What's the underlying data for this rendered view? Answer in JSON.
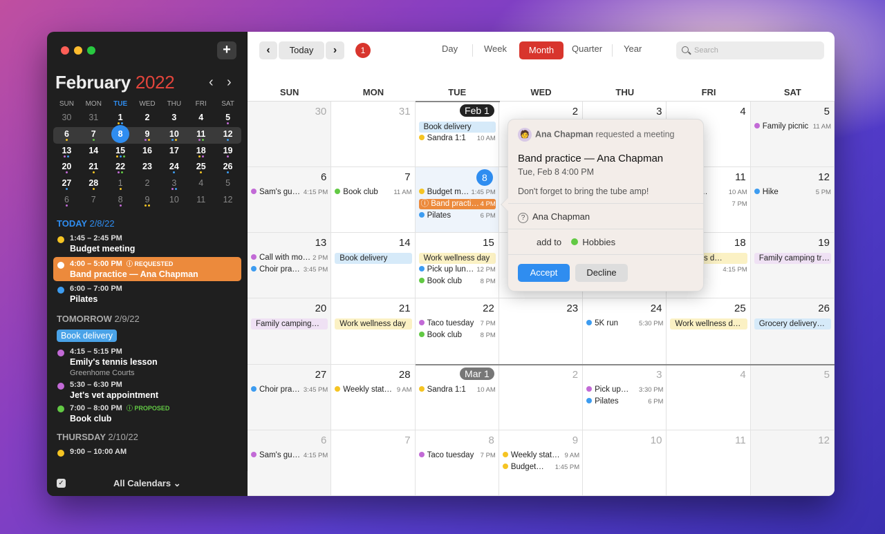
{
  "colors": {
    "yellow": "#f5c423",
    "orange": "#ec8a3c",
    "blue": "#3d9cf0",
    "green": "#62c944",
    "purple": "#c26ad6",
    "red": "#d8352d"
  },
  "sidebar": {
    "month": "February",
    "year": "2022",
    "dow": [
      "SUN",
      "MON",
      "TUE",
      "WED",
      "THU",
      "FRI",
      "SAT"
    ],
    "weeks": [
      [
        "30",
        "31",
        "1",
        "2",
        "3",
        "4",
        "5"
      ],
      [
        "6",
        "7",
        "8",
        "9",
        "10",
        "11",
        "12"
      ],
      [
        "13",
        "14",
        "15",
        "16",
        "17",
        "18",
        "19"
      ],
      [
        "20",
        "21",
        "22",
        "23",
        "24",
        "25",
        "26"
      ],
      [
        "27",
        "28",
        "1",
        "2",
        "3",
        "4",
        "5"
      ],
      [
        "6",
        "7",
        "8",
        "9",
        "10",
        "11",
        "12"
      ]
    ],
    "today_label": "TODAY",
    "today_date": "2/8/22",
    "tomorrow_label": "TOMORROW",
    "tomorrow_date": "2/9/22",
    "thursday_label": "THURSDAY",
    "thursday_date": "2/10/22",
    "today_items": [
      {
        "time": "1:45 – 2:45 PM",
        "title": "Budget meeting"
      },
      {
        "time": "4:00 – 5:00 PM",
        "tag": "REQUESTED",
        "title": "Band practice — Ana Chapman"
      },
      {
        "time": "6:00 – 7:00 PM",
        "title": "Pilates"
      }
    ],
    "book_delivery": "Book delivery",
    "tomorrow_items": [
      {
        "time": "4:15 – 5:15 PM",
        "title": "Emily's tennis lesson",
        "sub": "Greenhome Courts"
      },
      {
        "time": "5:30 – 6:30 PM",
        "title": "Jet's vet appointment"
      },
      {
        "time": "7:00 – 8:00 PM",
        "tag": "PROPOSED",
        "title": "Book club"
      }
    ],
    "thursday_item_time": "9:00 – 10:00 AM",
    "all_calendars": "All Calendars ⌄"
  },
  "toolbar": {
    "today": "Today",
    "badge": "1",
    "views": [
      "Day",
      "Week",
      "Month",
      "Quarter",
      "Year"
    ],
    "search_placeholder": "Search"
  },
  "grid": {
    "dow": [
      "SUN",
      "MON",
      "TUE",
      "WED",
      "THU",
      "FRI",
      "SAT"
    ],
    "days": [
      [
        "30",
        "31",
        "Feb 1",
        "2",
        "3",
        "4",
        "5"
      ],
      [
        "6",
        "7",
        "8",
        "9",
        "10",
        "11",
        "12"
      ],
      [
        "13",
        "14",
        "15",
        "16",
        "17",
        "18",
        "19"
      ],
      [
        "20",
        "21",
        "22",
        "23",
        "24",
        "25",
        "26"
      ],
      [
        "27",
        "28",
        "Mar 1",
        "2",
        "3",
        "4",
        "5"
      ],
      [
        "6",
        "7",
        "8",
        "9",
        "10",
        "11",
        "12"
      ]
    ],
    "events": {
      "r0c2": [
        {
          "t": "Book delivery",
          "bar": "#d6eaf9"
        },
        {
          "t": "Sandra 1:1",
          "time": "10 AM",
          "c": "yellow"
        }
      ],
      "r0c6": [
        {
          "t": "Family picnic",
          "time": "11 AM",
          "c": "purple"
        }
      ],
      "r1c0": [
        {
          "t": "Sam's gu…",
          "time": "4:15 PM",
          "c": "purple"
        }
      ],
      "r1c1": [
        {
          "t": "Book club",
          "time": "11 AM",
          "c": "green"
        }
      ],
      "r1c2": [
        {
          "t": "Budget m…",
          "time": "1:45 PM",
          "c": "yellow"
        },
        {
          "t": "Band practi…",
          "time": "4 PM",
          "sel": true
        },
        {
          "t": "Pilates",
          "time": "6 PM",
          "c": "blue"
        }
      ],
      "r1c5": [
        {
          "t": "…te d…",
          "time": "10 AM",
          "c": "none"
        },
        {
          "t": "…club",
          "time": "7 PM",
          "c": "none"
        }
      ],
      "r1c6": [
        {
          "t": "Hike",
          "time": "5 PM",
          "c": "blue"
        }
      ],
      "r2c0": [
        {
          "t": "Call with mo…",
          "time": "2 PM",
          "c": "purple"
        },
        {
          "t": "Choir pra…",
          "time": "3:45 PM",
          "c": "blue"
        }
      ],
      "r2c1": [
        {
          "t": "Book delivery",
          "bar": "#d6eaf9"
        }
      ],
      "r2c2": [
        {
          "t": "Work wellness day",
          "bar": "#fbf1c4"
        },
        {
          "t": "Pick up lun…",
          "time": "12 PM",
          "c": "blue"
        },
        {
          "t": "Book club",
          "time": "8 PM",
          "c": "green"
        }
      ],
      "r2c5": [
        {
          "t": "…ellness d…",
          "bar": "#fbf1c4"
        },
        {
          "t": "…gu…",
          "time": "4:15 PM",
          "c": "none"
        }
      ],
      "r2c6": [
        {
          "t": "Family camping tr…",
          "bar": "#efe1f4"
        }
      ],
      "r3c0": [
        {
          "t": "Family camping…",
          "bar": "#efe1f4"
        }
      ],
      "r3c1": [
        {
          "t": "Work wellness day",
          "bar": "#fbf1c4"
        }
      ],
      "r3c2": [
        {
          "t": "Taco tuesday",
          "time": "7 PM",
          "c": "purple"
        },
        {
          "t": "Book club",
          "time": "8 PM",
          "c": "green"
        }
      ],
      "r3c4": [
        {
          "t": "5K run",
          "time": "5:30 PM",
          "c": "blue"
        }
      ],
      "r3c5": [
        {
          "t": "Work wellness d…",
          "bar": "#fbf1c4"
        }
      ],
      "r3c6": [
        {
          "t": "Grocery delivery…",
          "bar": "#d6eaf9"
        }
      ],
      "r4c0": [
        {
          "t": "Choir pra…",
          "time": "3:45 PM",
          "c": "blue"
        }
      ],
      "r4c1": [
        {
          "t": "Weekly stat…",
          "time": "9 AM",
          "c": "yellow"
        }
      ],
      "r4c2": [
        {
          "t": "Sandra 1:1",
          "time": "10 AM",
          "c": "yellow"
        }
      ],
      "r4c4": [
        {
          "t": "Pick up…",
          "time": "3:30 PM",
          "c": "purple"
        },
        {
          "t": "Pilates",
          "time": "6 PM",
          "c": "blue"
        }
      ],
      "r5c0": [
        {
          "t": "Sam's gu…",
          "time": "4:15 PM",
          "c": "purple"
        }
      ],
      "r5c2": [
        {
          "t": "Taco tuesday",
          "time": "7 PM",
          "c": "purple"
        }
      ],
      "r5c3": [
        {
          "t": "Weekly stat…",
          "time": "9 AM",
          "c": "yellow"
        },
        {
          "t": "Budget…",
          "time": "1:45 PM",
          "c": "yellow"
        }
      ]
    }
  },
  "popup": {
    "requester": "Ana Chapman",
    "requested": "requested a meeting",
    "title": "Band practice — Ana Chapman",
    "when": "Tue, Feb 8 4:00 PM",
    "note": "Don't forget to bring the tube amp!",
    "attendee": "Ana Chapman",
    "add_to": "add to",
    "calendar": "Hobbies",
    "accept": "Accept",
    "decline": "Decline"
  }
}
